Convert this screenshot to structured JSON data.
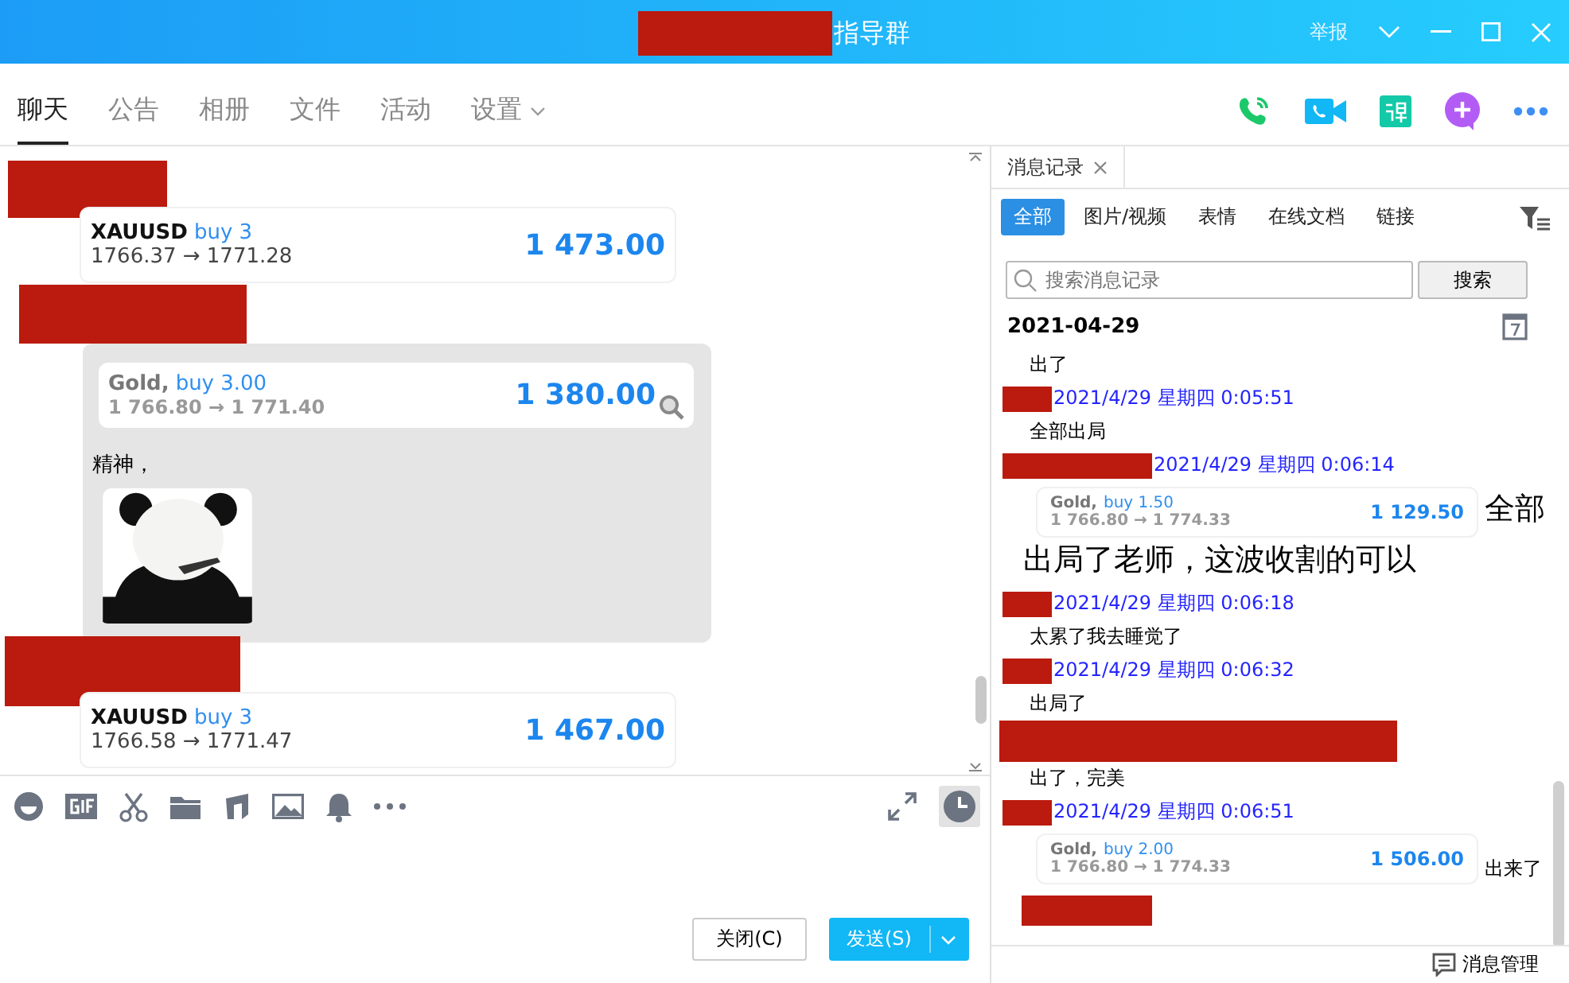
{
  "window": {
    "title": "指导群",
    "title_redacted": true,
    "report": "举报"
  },
  "tabs": [
    {
      "label": "聊天",
      "selected": true
    },
    {
      "label": "公告",
      "selected": false
    },
    {
      "label": "相册",
      "selected": false
    },
    {
      "label": "文件",
      "selected": false
    },
    {
      "label": "活动",
      "selected": false
    },
    {
      "label": "设置",
      "selected": false,
      "dropdown": true
    }
  ],
  "messages": [
    {
      "sender_redacted": true,
      "bubble": false,
      "card": {
        "kind": "dark",
        "symbol": "XAUUSD",
        "trade": "buy 3",
        "prices": "1766.37 → 1771.28",
        "amount": "1 473.00"
      }
    },
    {
      "sender_redacted": true,
      "bubble": true,
      "card": {
        "kind": "muted",
        "symbol": "Gold,",
        "trade": "buy 3.00",
        "prices": "1 766.80 → 1 771.40",
        "amount": "1 380.00"
      },
      "text": "精神，"
    },
    {
      "sender_redacted": true,
      "bubble": false,
      "card": {
        "kind": "dark",
        "symbol": "XAUUSD",
        "trade": "buy 3",
        "prices": "1766.58 → 1771.47",
        "amount": "1 467.00"
      }
    }
  ],
  "buttons": [
    {
      "label": "关闭(C)",
      "kind": "plain"
    },
    {
      "label": "发送(S)",
      "kind": "primary"
    }
  ],
  "history_panel": {
    "tab": "消息记录",
    "filters": [
      {
        "label": "全部",
        "selected": true
      },
      {
        "label": "图片/视频",
        "selected": false
      },
      {
        "label": "表情",
        "selected": false
      },
      {
        "label": "在线文档",
        "selected": false
      },
      {
        "label": "链接",
        "selected": false
      }
    ],
    "search": {
      "placeholder": "搜索消息记录",
      "button": "搜索"
    },
    "date": "2021-04-29",
    "entries": [
      {
        "kind": "text",
        "text": "出了"
      },
      {
        "kind": "meta",
        "time": "2021/4/29 星期四 0:05:51"
      },
      {
        "kind": "text",
        "text": "全部出局"
      },
      {
        "kind": "meta",
        "time": "2021/4/29 星期四 0:06:14",
        "wide": true
      },
      {
        "kind": "card",
        "card": {
          "kind": "muted",
          "symbol": "Gold,",
          "trade": "buy 1.50",
          "prices": "1 766.80 → 1 774.33",
          "amount": "1 129.50"
        },
        "text": "全部",
        "text_continued": "出局了老师，这波收割的可以",
        "large": true
      },
      {
        "kind": "meta",
        "time": "2021/4/29 星期四 0:06:18"
      },
      {
        "kind": "text",
        "text": "太累了我去睡觉了"
      },
      {
        "kind": "meta",
        "time": "2021/4/29 星期四 0:06:32"
      },
      {
        "kind": "text",
        "text": "出局了"
      },
      {
        "kind": "redacted"
      },
      {
        "kind": "text",
        "text": "出了，完美"
      },
      {
        "kind": "meta",
        "time": "2021/4/29 星期四 0:06:51"
      },
      {
        "kind": "card",
        "card": {
          "kind": "muted",
          "symbol": "Gold,",
          "trade": "buy 2.00",
          "prices": "1 766.80 → 1 774.33",
          "amount": "1 506.00"
        },
        "text": "出来了",
        "large": false
      },
      {
        "kind": "redacted",
        "short": true
      }
    ],
    "manage": "消息管理"
  }
}
